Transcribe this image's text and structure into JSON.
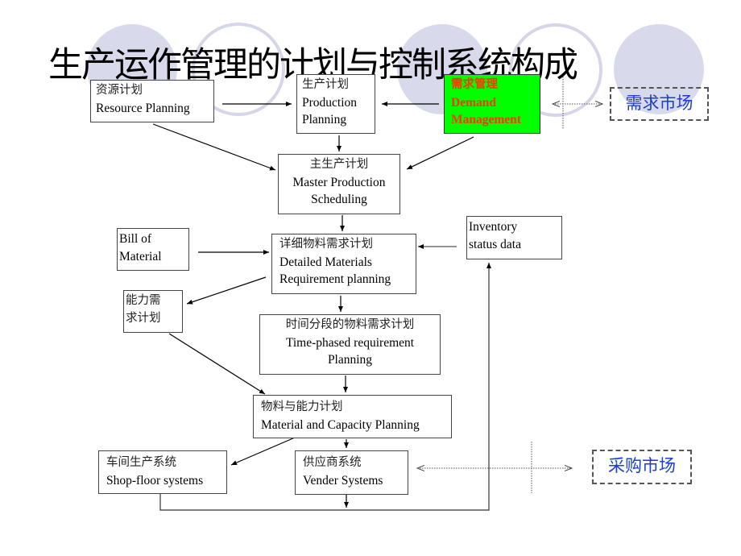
{
  "title": "生产运作管理的计划与控制系统构成",
  "colors": {
    "circle_fill": "#d9d9ec",
    "demand_box_fill": "#00ff00",
    "demand_box_text": "#ff3300",
    "market_text": "#1a3fcc"
  },
  "nodes": {
    "resource_planning": {
      "zh": "资源计划",
      "en": [
        "Resource Planning"
      ]
    },
    "production_planning": {
      "zh": "生产计划",
      "en": [
        "Production",
        "Planning"
      ]
    },
    "demand_management": {
      "zh": "需求管理",
      "en": [
        "Demand",
        "Management"
      ]
    },
    "demand_market": {
      "label": "需求市场"
    },
    "master_production": {
      "zh": "主生产计划",
      "en": [
        "Master Production",
        "Scheduling"
      ]
    },
    "bill_of_material": {
      "en": [
        "Bill of",
        "Material"
      ]
    },
    "detailed_materials": {
      "zh": "详细物料需求计划",
      "en": [
        "Detailed Materials",
        "Requirement planning"
      ]
    },
    "inventory_status": {
      "en": [
        "Inventory",
        "status data"
      ]
    },
    "capacity_requirement": {
      "zh": [
        "能力需",
        "求计划"
      ]
    },
    "time_phased": {
      "zh": "时间分段的物料需求计划",
      "en": [
        "Time-phased requirement",
        "Planning"
      ]
    },
    "material_capacity": {
      "zh": "物料与能力计划",
      "en": [
        "Material and Capacity Planning"
      ]
    },
    "shop_floor": {
      "zh": "车间生产系统",
      "en": [
        "Shop-floor systems"
      ]
    },
    "vender_systems": {
      "zh": "供应商系统",
      "en": [
        "Vender Systems"
      ]
    },
    "procurement_market": {
      "label": "采购市场"
    }
  }
}
